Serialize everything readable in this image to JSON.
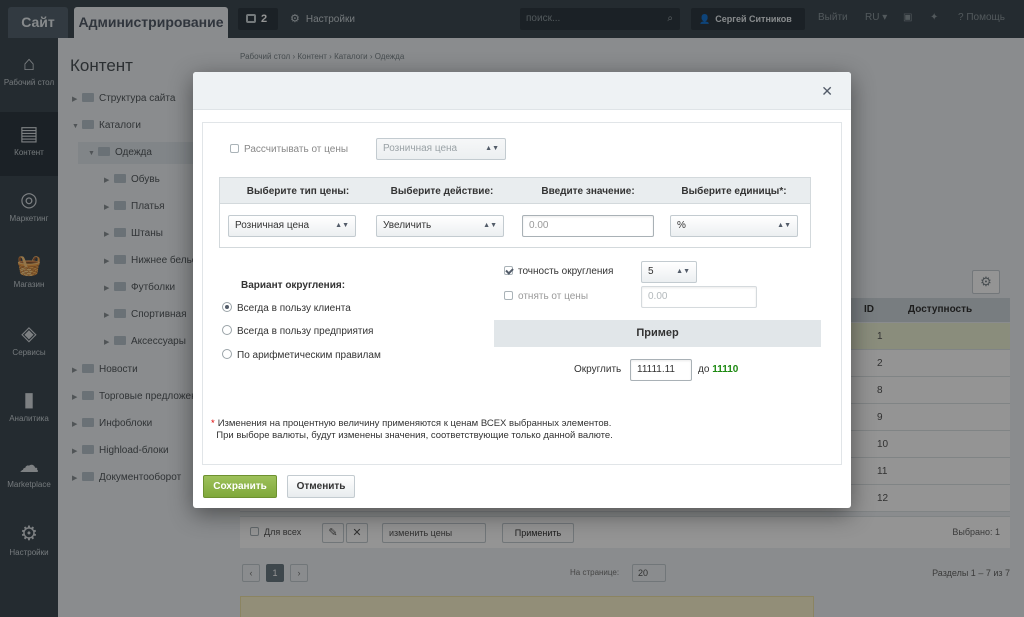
{
  "topbar": {
    "site": "Сайт",
    "admin": "Администрирование",
    "notifications": "2",
    "settings": "Настройки",
    "search_placeholder": "поиск...",
    "user": "Сергей Ситников",
    "logout": "Выйти",
    "lang": "RU",
    "help": "Помощь"
  },
  "sidebar": {
    "items": [
      {
        "label": "Рабочий стол",
        "icon": "home-icon"
      },
      {
        "label": "Контент",
        "icon": "content-icon"
      },
      {
        "label": "Маркетинг",
        "icon": "target-icon"
      },
      {
        "label": "Магазин",
        "icon": "basket-icon"
      },
      {
        "label": "Сервисы",
        "icon": "layers-icon"
      },
      {
        "label": "Аналитика",
        "icon": "chart-icon"
      },
      {
        "label": "Marketplace",
        "icon": "cloud-download-icon"
      },
      {
        "label": "Настройки",
        "icon": "gear-icon"
      }
    ]
  },
  "tree": {
    "title": "Контент",
    "items": [
      "Структура сайта",
      "Каталоги",
      "Одежда",
      "Обувь",
      "Платья",
      "Штаны",
      "Нижнее белье",
      "Футболки",
      "Спортивная",
      "Аксессуары",
      "Новости",
      "Торговые предложения",
      "Инфоблоки",
      "Highload-блоки",
      "Документооборот"
    ]
  },
  "main": {
    "breadcrumbs": "Рабочий стол  ›  Контент  ›  Каталоги  ›  Одежда",
    "col_id": "ID",
    "col_availability": "Доступность",
    "row_ids": [
      "1",
      "2",
      "8",
      "9",
      "10",
      "11",
      "12"
    ],
    "for_all": "Для всех",
    "change_prices": "изменить цены",
    "apply": "Применить",
    "selected": "Выбрано: 1",
    "page": "1",
    "per_page_label": "На странице:",
    "per_page": "20",
    "sections": "Разделы 1 – 7 из 7"
  },
  "modal": {
    "calc_from_price_label": "Рассчитывать от цены",
    "calc_from_price_select": "Розничная цена",
    "headers": {
      "price_type": "Выберите тип цены:",
      "action": "Выберите действие:",
      "value": "Введите значение:",
      "units": "Выберите единицы*:"
    },
    "price_type_value": "Розничная цена",
    "action_value": "Увеличить",
    "value_placeholder": "0.00",
    "units_value": "%",
    "rounding_title": "Вариант округления:",
    "radio_client": "Всегда в пользу клиента",
    "radio_company": "Всегда в пользу предприятия",
    "radio_arith": "По арифметическим правилам",
    "precision_label": "точность округления",
    "precision_value": "5",
    "subtract_label": "отнять от цены",
    "subtract_value": "0.00",
    "example_title": "Пример",
    "round_label": "Округлить",
    "round_input": "11111.11",
    "to_label": "до",
    "to_value": "11110",
    "note_line1": "Изменения на процентную величину применяются к ценам ВСЕХ выбранных элементов.",
    "note_line2": "При выборе валюты, будут изменены значения, соответствующие только данной валюте.",
    "save": "Сохранить",
    "cancel": "Отменить"
  },
  "colors": {
    "accent_green": "#7fa83a",
    "result_green": "#1e8a12",
    "dark_panel": "#3f4b54"
  }
}
